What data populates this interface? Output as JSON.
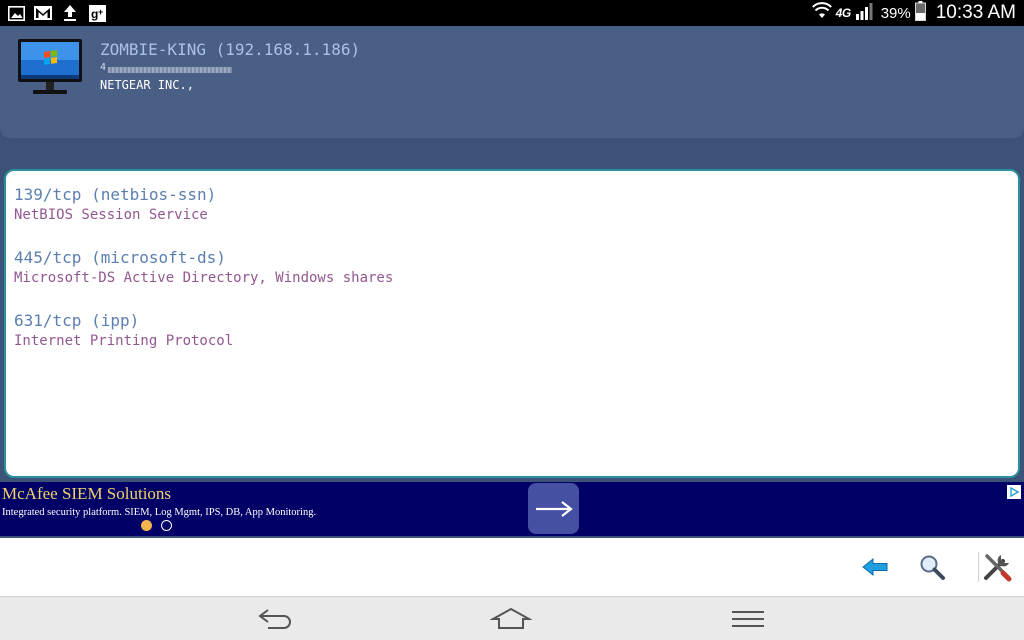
{
  "status_bar": {
    "left_icons": [
      "gallery-icon",
      "gmail-icon",
      "upload-icon",
      "google-plus-icon"
    ],
    "network": "4G",
    "battery": "39%",
    "time": "10:33 AM"
  },
  "device": {
    "name": "ZOMBIE-KING (192.168.1.186)",
    "mac_visible": "4",
    "vendor": "NETGEAR INC.,"
  },
  "ports": [
    {
      "name": "139/tcp (netbios-ssn)",
      "description": "NetBIOS Session Service"
    },
    {
      "name": "445/tcp (microsoft-ds)",
      "description": "Microsoft-DS Active Directory, Windows shares"
    },
    {
      "name": "631/tcp (ipp)",
      "description": "Internet Printing Protocol"
    }
  ],
  "ad": {
    "title": "McAfee SIEM Solutions",
    "text": "Integrated security platform. SIEM, Log Mgmt, IPS, DB, App Monitoring."
  },
  "toolbar": {
    "icons": [
      "back-arrow-icon",
      "search-icon",
      "tools-icon"
    ]
  },
  "navbar": {
    "icons": [
      "back-icon",
      "home-icon",
      "menu-icon"
    ]
  },
  "colors": {
    "app_background": "#3d5277",
    "header_card": "#4a5f86",
    "panel_border": "#2a8f9f",
    "port_name": "#5b7fb0",
    "port_desc": "#93578f",
    "ad_background": "#000066",
    "ad_title": "#f2d36b"
  }
}
